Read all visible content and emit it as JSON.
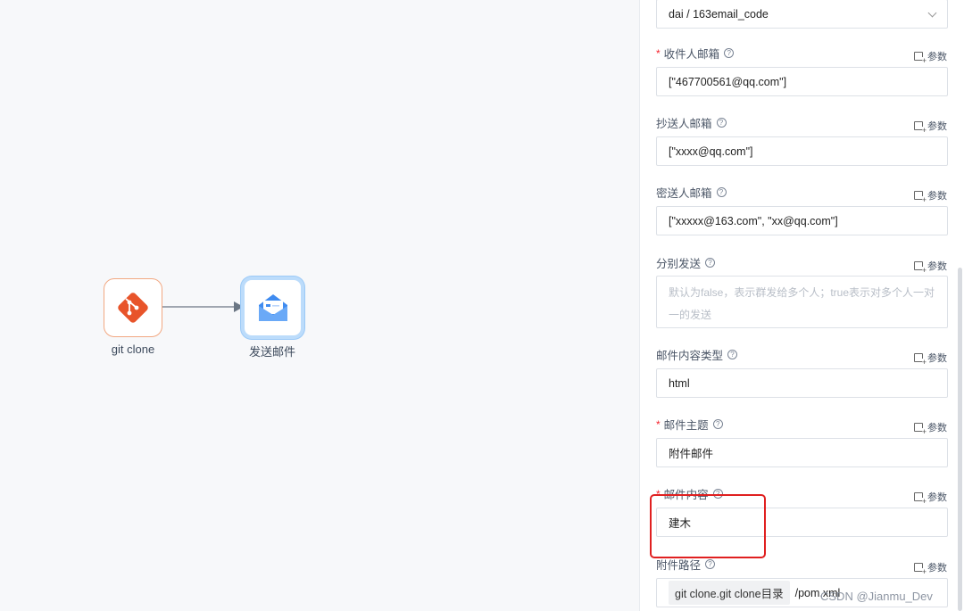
{
  "canvas": {
    "nodes": [
      {
        "label": "git clone",
        "icon": "git-icon",
        "color": "#e8542a"
      },
      {
        "label": "发送邮件",
        "icon": "mail-icon",
        "color": "#3f8bf0"
      }
    ]
  },
  "panel": {
    "param_label": "参数",
    "credential_select": {
      "value": "dai / 163email_code"
    },
    "fields": [
      {
        "label": "收件人邮箱",
        "required": true,
        "value": "[\"467700561@qq.com\"]"
      },
      {
        "label": "抄送人邮箱",
        "required": false,
        "value": "[\"xxxx@qq.com\"]"
      },
      {
        "label": "密送人邮箱",
        "required": false,
        "value": "[\"xxxxx@163.com\", \"xx@qq.com\"]"
      },
      {
        "label": "分别发送",
        "required": false,
        "placeholder": "默认为false，表示群发给多个人；true表示对多个人一对一的发送"
      },
      {
        "label": "邮件内容类型",
        "required": false,
        "value": "html"
      },
      {
        "label": "邮件主题",
        "required": true,
        "value": "附件邮件"
      },
      {
        "label": "邮件内容",
        "required": true,
        "value": "建木"
      },
      {
        "label": "附件路径",
        "required": false,
        "chip": "git clone.git clone目录",
        "value": "/pom.xml"
      }
    ]
  },
  "watermark": "CSDN @Jianmu_Dev",
  "colors": {
    "required": "#f5222d",
    "highlight": "#e02020",
    "accent": "#3f8bf0",
    "git": "#e8542a"
  }
}
